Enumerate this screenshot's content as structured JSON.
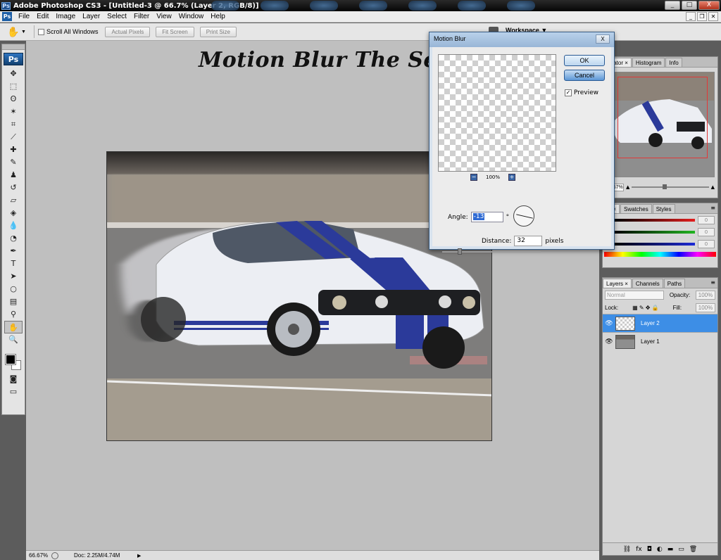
{
  "window": {
    "title": "Adobe Photoshop CS3 - [Untitled-3 @ 66.7% (Layer 2, RGB/8)]",
    "minimize": "_",
    "maximize": "□",
    "close": "X",
    "app_badge": "Ps"
  },
  "menu": {
    "items": [
      "File",
      "Edit",
      "Image",
      "Layer",
      "Select",
      "Filter",
      "View",
      "Window",
      "Help"
    ],
    "doc_controls": [
      "_",
      "❐",
      "✕"
    ]
  },
  "options_bar": {
    "scroll_all_windows": "Scroll All Windows",
    "actual_pixels": "Actual Pixels",
    "fit_screen": "Fit Screen",
    "print_size": "Print Size",
    "workspace": "Workspace ▼"
  },
  "tools": {
    "logo": "Ps",
    "icons": [
      "move-icon",
      "marquee-icon",
      "lasso-icon",
      "magic-wand-icon",
      "crop-icon",
      "slice-icon",
      "healing-brush-icon",
      "brush-icon",
      "clone-stamp-icon",
      "history-brush-icon",
      "eraser-icon",
      "paint-bucket-icon",
      "blur-icon",
      "dodge-icon",
      "pen-icon",
      "type-icon",
      "path-selection-icon",
      "ellipse-icon",
      "notes-icon",
      "eyedropper-icon",
      "hand-icon",
      "zoom-icon"
    ],
    "active_tool": "hand-icon"
  },
  "canvas": {
    "title_text": "Motion Blur The Selection"
  },
  "status_bar": {
    "zoom": "66.67%",
    "doc": "Doc: 2.25M/4.74M"
  },
  "motion_blur": {
    "title": "Motion Blur",
    "ok": "OK",
    "cancel": "Cancel",
    "preview_label": "Preview",
    "preview_checked": true,
    "zoom_percent": "100%",
    "zoom_out": "−",
    "zoom_in": "+",
    "angle_label": "Angle:",
    "angle_value": "-13",
    "angle_unit": "°",
    "distance_label": "Distance:",
    "distance_value": "32",
    "distance_unit": "pixels"
  },
  "panels": {
    "navigator_tabs": [
      "vigator ×",
      "Histogram",
      "Info"
    ],
    "color_tabs": [
      "or ×",
      "Swatches",
      "Styles"
    ],
    "color_rows": [
      {
        "label": "R",
        "value": "0",
        "color": "#e31d1d"
      },
      {
        "label": "G",
        "value": "0",
        "color": "#21b521"
      },
      {
        "label": "B",
        "value": "0",
        "color": "#1d2ad6"
      }
    ],
    "layers_tabs": [
      "Layers ×",
      "Channels",
      "Paths"
    ],
    "blend_mode": "Normal",
    "opacity_label": "Opacity:",
    "opacity_value": "100%",
    "lock_label": "Lock:",
    "fill_label": "Fill:",
    "fill_value": "100%",
    "layers": [
      {
        "name": "Layer 2",
        "selected": true
      },
      {
        "name": "Layer 1",
        "selected": false
      }
    ]
  },
  "colors": {
    "selection_blue": "#3d8ee6",
    "stripe_blue": "#2b3a9a",
    "dialog_frame": "#d7e2ee"
  }
}
